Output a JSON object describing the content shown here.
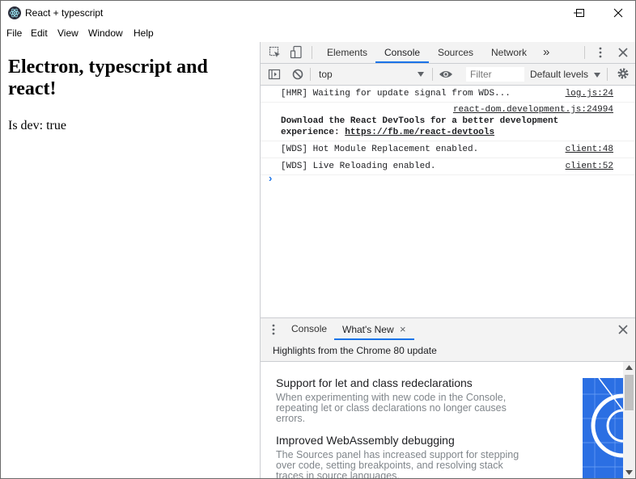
{
  "window": {
    "title": "React + typescript",
    "menu": [
      "File",
      "Edit",
      "View",
      "Window",
      "Help"
    ]
  },
  "page": {
    "heading": "Electron, typescript and react!",
    "dev_status": "Is dev: true"
  },
  "devtools": {
    "tabs": [
      "Elements",
      "Console",
      "Sources",
      "Network"
    ],
    "active_tab": "Console",
    "more_tabs": "»",
    "context": "top",
    "filter_placeholder": "Filter",
    "levels": "Default levels",
    "messages": [
      {
        "text": "[HMR] Waiting for update signal from WDS...",
        "source": "log.js:24"
      },
      {
        "source": "react-dom.development.js:24994",
        "line1": "Download the React DevTools for a better development",
        "line2_prefix": "experience: ",
        "link": "https://fb.me/react-devtools"
      },
      {
        "text": "[WDS] Hot Module Replacement enabled.",
        "source": "client:48"
      },
      {
        "text": "[WDS] Live Reloading enabled.",
        "source": "client:52"
      }
    ],
    "prompt_symbol": "›",
    "drawer": {
      "tabs": [
        "Console",
        "What's New"
      ],
      "active_tab": "What's New",
      "close_symbol": "×",
      "highlights": "Highlights from the Chrome 80 update",
      "features": [
        {
          "title": "Support for let and class redeclarations",
          "desc": "When experimenting with new code in the Console, repeating let or class declarations no longer causes errors."
        },
        {
          "title": "Improved WebAssembly debugging",
          "desc": "The Sources panel has increased support for stepping over code, setting breakpoints, and resolving stack traces in source languages."
        }
      ]
    },
    "colors": {
      "accent": "#1a73e8",
      "toolbar": "#f3f3f3",
      "promo": "#2b6fe3"
    }
  }
}
